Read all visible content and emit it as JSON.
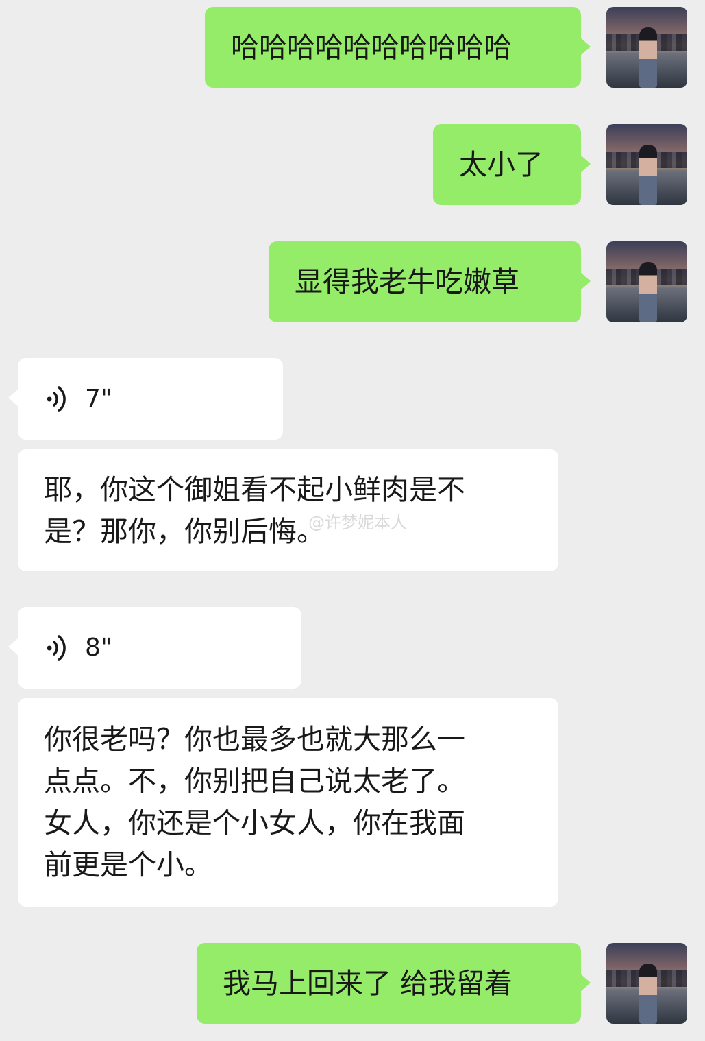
{
  "messages": [
    {
      "side": "out",
      "text": "哈哈哈哈哈哈哈哈哈哈"
    },
    {
      "side": "out",
      "text": "太小了"
    },
    {
      "side": "out",
      "text": "显得我老牛吃嫩草"
    },
    {
      "side": "in",
      "type": "voice",
      "duration": "7\""
    },
    {
      "side": "in",
      "lines": [
        "耶，你这个御姐看不起小鲜肉是不",
        "是？那你，你别后悔。"
      ]
    },
    {
      "side": "in",
      "type": "voice",
      "duration": "8\""
    },
    {
      "side": "in",
      "lines": [
        "你很老吗？你也最多也就大那么一",
        "点点。不，你别把自己说太老了。",
        "女人，你还是个小女人，你在我面",
        "前更是个小。"
      ]
    },
    {
      "side": "out",
      "text": "我马上回来了 给我留着"
    }
  ],
  "watermark": "@许梦妮本人",
  "colors": {
    "outgoing": "#95ec69",
    "incoming": "#ffffff",
    "background": "#ededed"
  },
  "icons": {
    "voice": "voice-wave-icon",
    "avatar": "avatar-photo"
  }
}
